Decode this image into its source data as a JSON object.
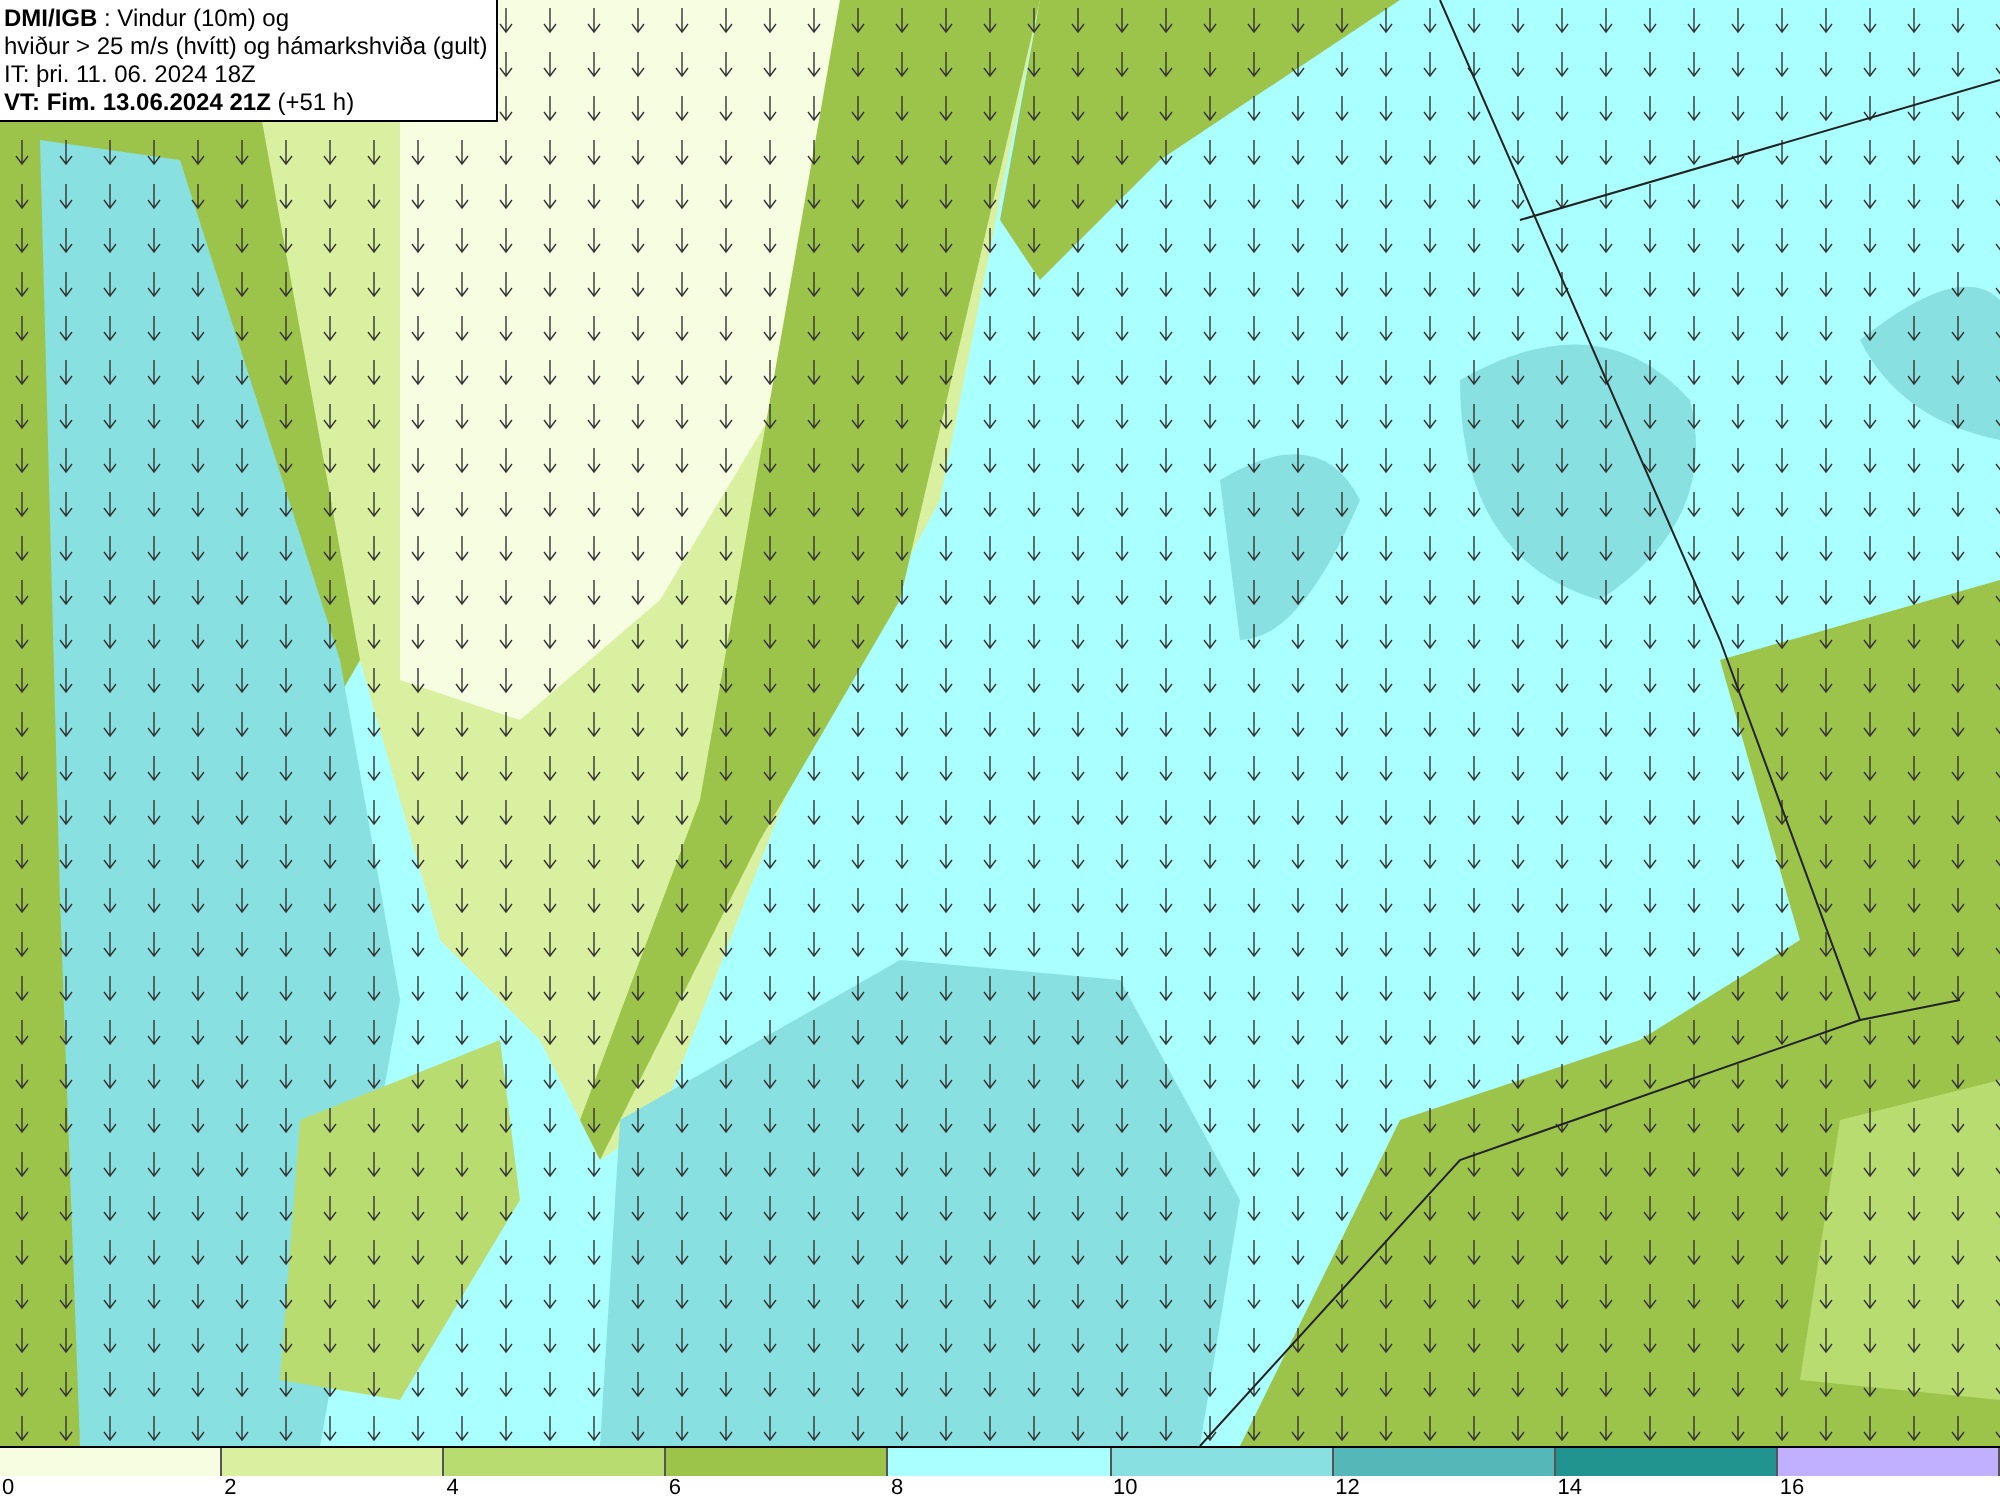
{
  "header": {
    "lines": [
      "**DMI/IGB** : Vindur (10m) og",
      "hviður > 25 m/s (hvítt) og hámarkshviða (gult)",
      "IT: þri. 11. 06. 2024 18Z",
      "**VT: Fim. 13.06.2024 21Z** (+51 h)"
    ]
  },
  "legend": {
    "bins": [
      {
        "color": "#f7fde0",
        "label": "0"
      },
      {
        "color": "#d9f0a0",
        "label": "2"
      },
      {
        "color": "#b8dc70",
        "label": "4"
      },
      {
        "color": "#9cc44a",
        "label": "6"
      },
      {
        "color": "#aaffff",
        "label": "8"
      },
      {
        "color": "#88e0e0",
        "label": "10"
      },
      {
        "color": "#55b8b8",
        "label": "12"
      },
      {
        "color": "#229490",
        "label": "14"
      },
      {
        "color": "#c0b0ff",
        "label": "16"
      }
    ]
  }
}
